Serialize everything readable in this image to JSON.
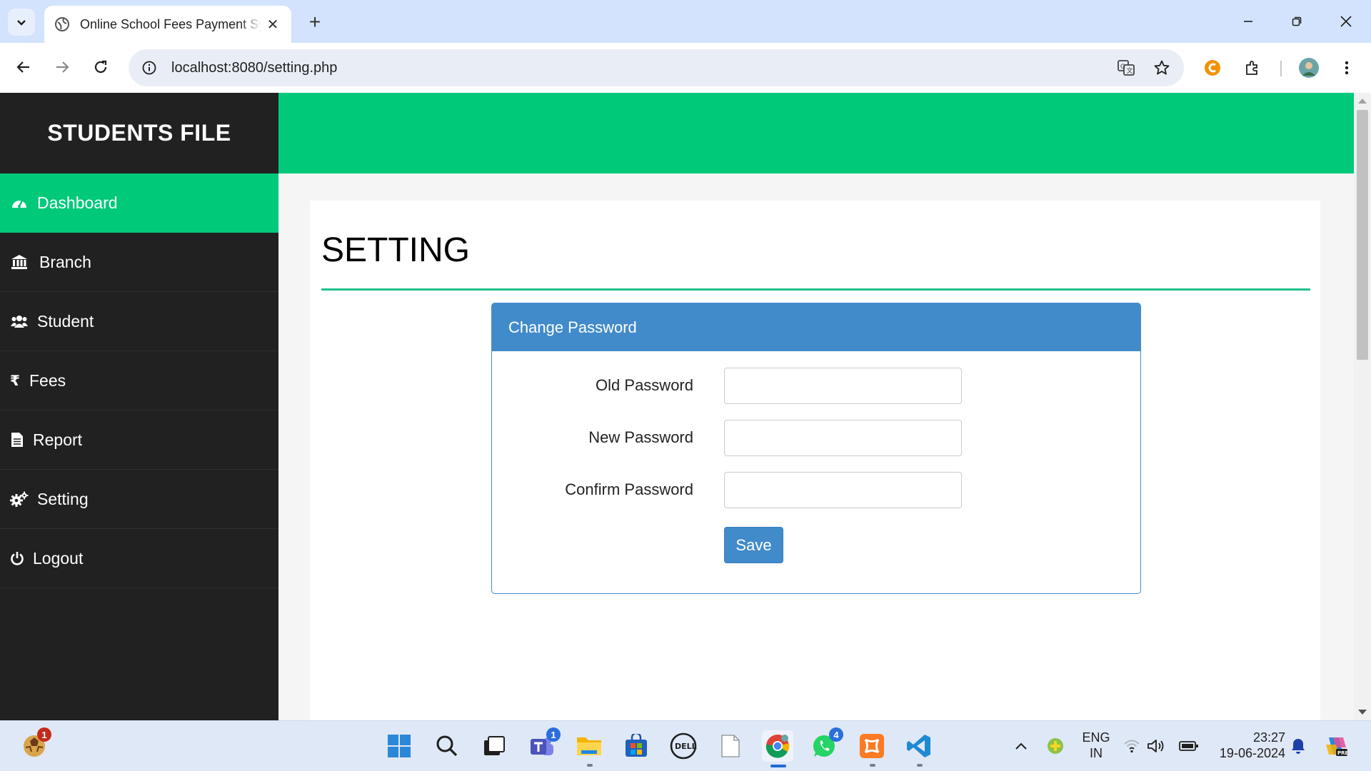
{
  "browser": {
    "tab_title": "Online School Fees Payment System",
    "url": "localhost:8080/setting.php"
  },
  "sidebar": {
    "brand": "STUDENTS FILE",
    "items": [
      {
        "label": "Dashboard",
        "icon": "dashboard-icon",
        "active": true
      },
      {
        "label": "Branch",
        "icon": "bank-icon"
      },
      {
        "label": "Student",
        "icon": "users-icon"
      },
      {
        "label": "Fees",
        "icon": "rupee-icon"
      },
      {
        "label": "Report",
        "icon": "document-icon"
      },
      {
        "label": "Setting",
        "icon": "gears-icon"
      },
      {
        "label": "Logout",
        "icon": "power-icon"
      }
    ]
  },
  "main": {
    "heading": "SETTING",
    "panel_title": "Change Password",
    "fields": [
      {
        "label": "Old Password",
        "value": ""
      },
      {
        "label": "New Password",
        "value": ""
      },
      {
        "label": "Confirm Password",
        "value": ""
      }
    ],
    "save_label": "Save"
  },
  "taskbar": {
    "notification_badge": "1",
    "teams_badge": "1",
    "whatsapp_badge": "4",
    "language_line1": "ENG",
    "language_line2": "IN",
    "time": "23:27",
    "date": "19-06-2024"
  },
  "colors": {
    "accent_green": "#00c97a",
    "sidebar_bg": "#212121",
    "panel_blue": "#428bca"
  }
}
